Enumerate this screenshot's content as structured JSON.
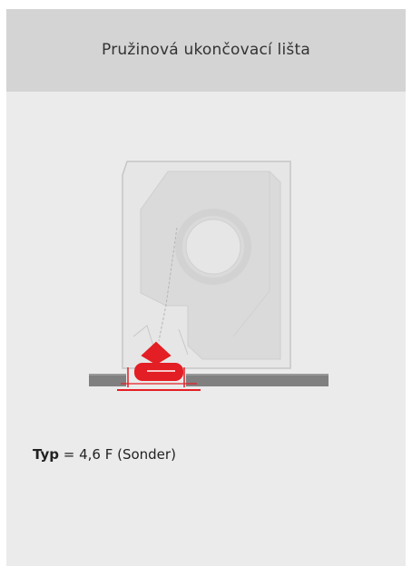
{
  "card": {
    "title": "Pružinová ukončovací lišta"
  },
  "figure": {
    "icon": "spring-end-rail-diagram",
    "colors": {
      "panel_fill": "#e4e4e4",
      "panel_stroke": "#c4c4c4",
      "rail": "#808080",
      "highlight": "#e31e24",
      "background": "#ebebeb"
    }
  },
  "spec": {
    "label": "Typ",
    "value": "= 4,6 F (Sonder)"
  }
}
